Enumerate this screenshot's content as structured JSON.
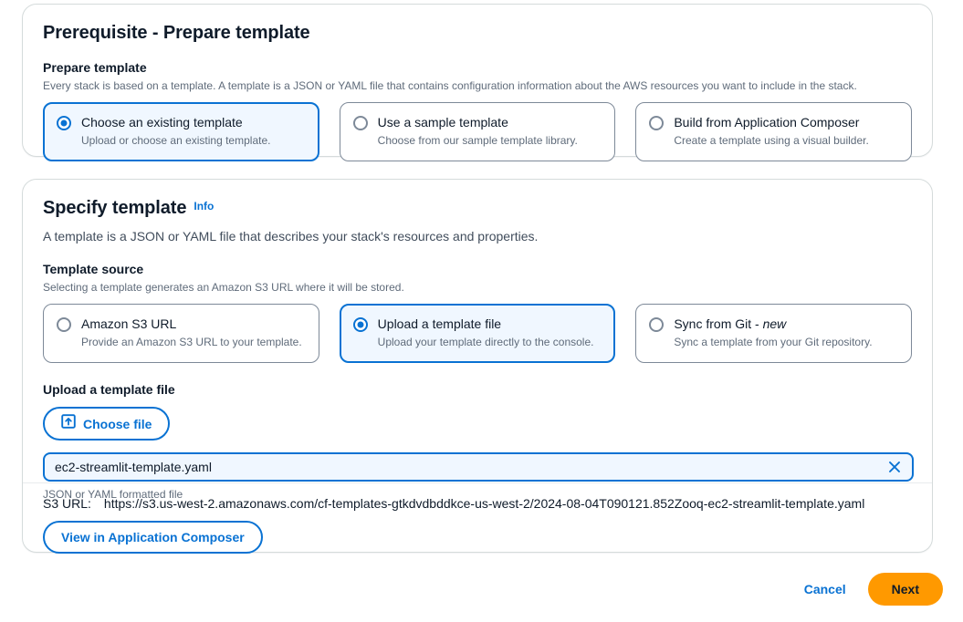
{
  "prerequisite": {
    "section_title": "Prerequisite - Prepare template",
    "field_label": "Prepare template",
    "field_desc": "Every stack is based on a template. A template is a JSON or YAML file that contains configuration information about the AWS resources you want to include in the stack.",
    "options": [
      {
        "title": "Choose an existing template",
        "sub": "Upload or choose an existing template.",
        "selected": true
      },
      {
        "title": "Use a sample template",
        "sub": "Choose from our sample template library.",
        "selected": false
      },
      {
        "title": "Build from Application Composer",
        "sub": "Create a template using a visual builder.",
        "selected": false
      }
    ]
  },
  "specify": {
    "section_title": "Specify template",
    "info_label": "Info",
    "section_desc": "A template is a JSON or YAML file that describes your stack's resources and properties.",
    "source_label": "Template source",
    "source_desc": "Selecting a template generates an Amazon S3 URL where it will be stored.",
    "options": [
      {
        "title": "Amazon S3 URL",
        "sub": "Provide an Amazon S3 URL to your template.",
        "selected": false
      },
      {
        "title": "Upload a template file",
        "sub": "Upload your template directly to the console.",
        "selected": true
      },
      {
        "title_prefix": "Sync from Git - ",
        "title_tag": "new",
        "sub": "Sync a template from your Git repository.",
        "selected": false
      }
    ],
    "upload": {
      "label": "Upload a template file",
      "choose_file_label": "Choose file",
      "choose_file_icon": "upload-icon",
      "file_value": "ec2-streamlit-template.yaml",
      "file_placeholder": "",
      "clear_icon": "close-icon",
      "hint": "JSON or YAML formatted file"
    },
    "s3": {
      "label": "S3 URL:",
      "url": "https://s3.us-west-2.amazonaws.com/cf-templates-gtkdvdbddkce-us-west-2/2024-08-04T090121.852Zooq-ec2-streamlit-template.yaml",
      "composer_button_label": "View in Application Composer"
    }
  },
  "footer": {
    "cancel_label": "Cancel",
    "next_label": "Next"
  },
  "colors": {
    "accent_blue": "#0972d3",
    "selected_bg": "#f0f7ff",
    "primary_orange": "#ff9900",
    "border_grey": "#7d8998",
    "text_dark": "#0f1b2a",
    "text_muted": "#5f6b7a"
  }
}
